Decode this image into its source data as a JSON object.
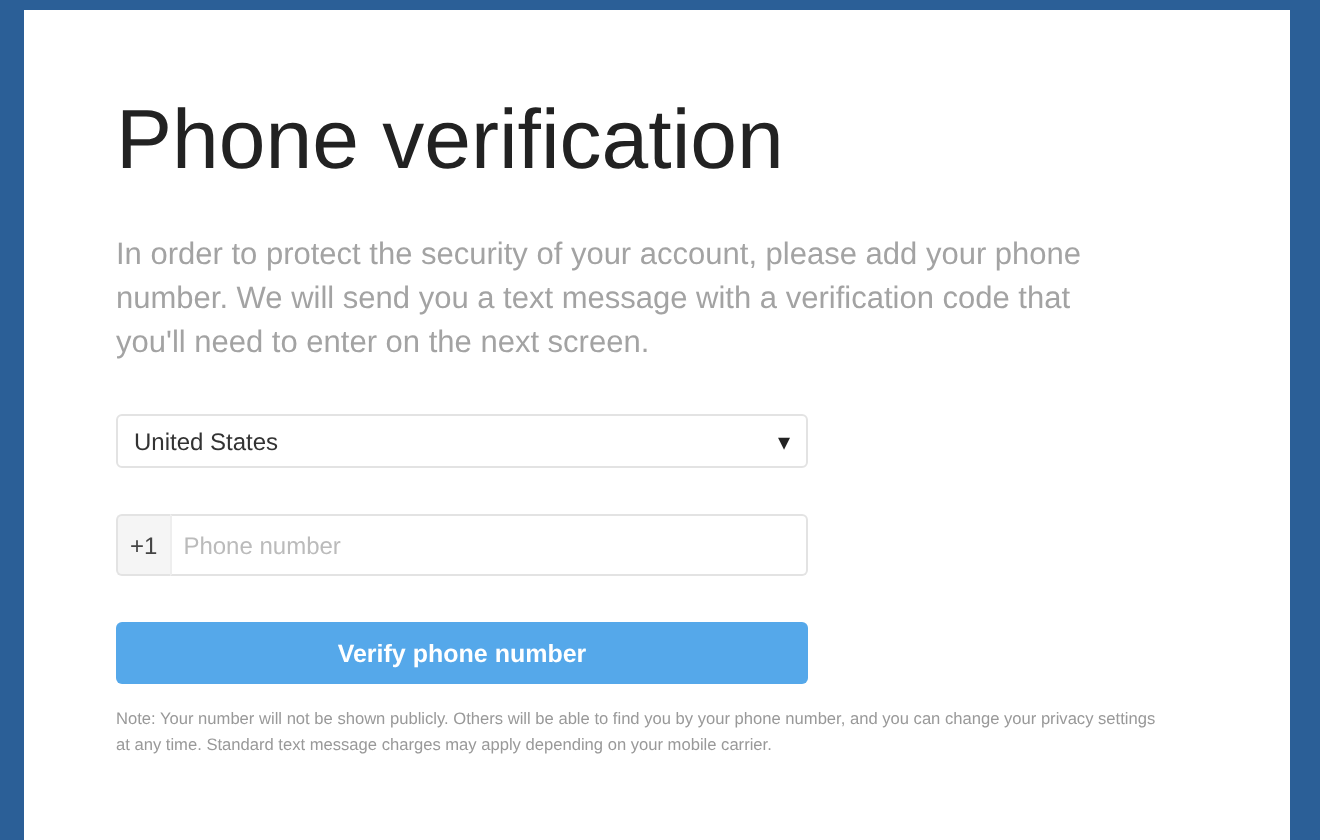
{
  "title": "Phone verification",
  "intro": "In order to protect the security of your account, please add your phone number. We will send you a text message with a verification code that you'll need to enter on the next screen.",
  "country": {
    "value": "United States",
    "caret": "▾"
  },
  "phone": {
    "prefix": "+1",
    "placeholder": "Phone number"
  },
  "button": "Verify phone number",
  "note": "Note: Your number will not be shown publicly. Others will be able to find you by your phone number, and you can change your privacy settings at any time. Standard text message charges may apply depending on your mobile carrier."
}
